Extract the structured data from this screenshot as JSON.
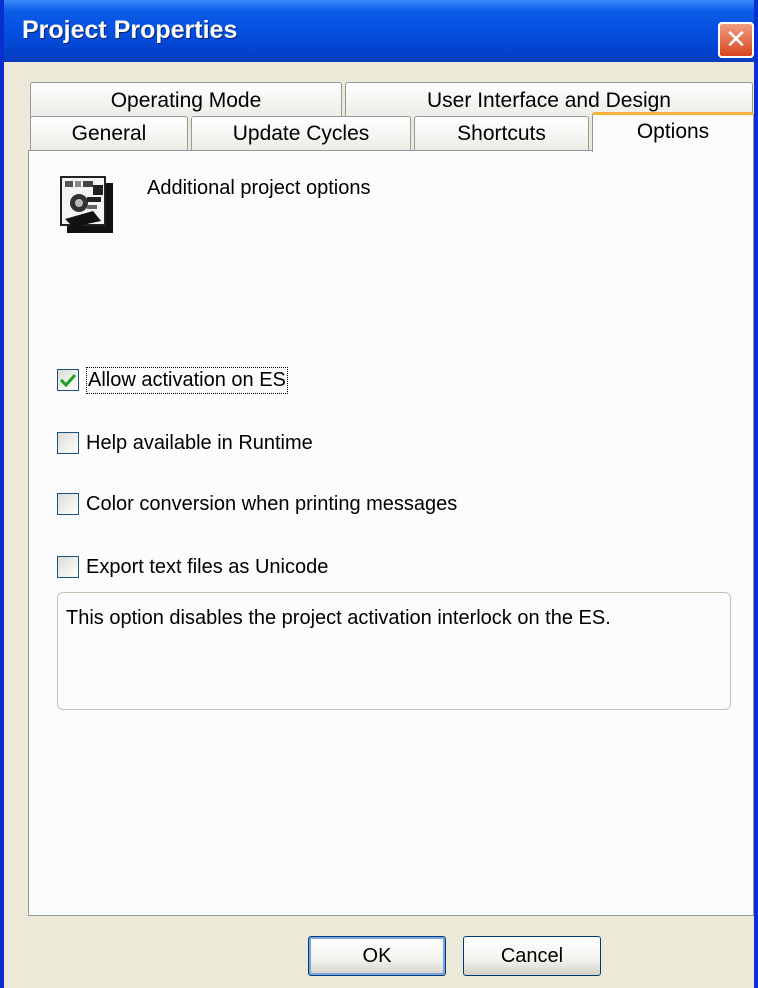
{
  "window": {
    "title": "Project Properties",
    "close_glyph": "✕"
  },
  "tabs": {
    "row_back": [
      {
        "label": "Operating Mode"
      },
      {
        "label": "User Interface and Design"
      }
    ],
    "row_front": [
      {
        "label": "General"
      },
      {
        "label": "Update Cycles"
      },
      {
        "label": "Shortcuts"
      },
      {
        "label": "Options",
        "active": true
      }
    ]
  },
  "options_panel": {
    "header": "Additional project options",
    "icon": "project-options-icon",
    "checkboxes": [
      {
        "label": "Allow activation on ES",
        "checked": true
      },
      {
        "label": "Help available in Runtime",
        "checked": false
      },
      {
        "label": "Color conversion when printing messages",
        "checked": false
      },
      {
        "label": "Export text files as Unicode",
        "checked": false
      }
    ],
    "description": "This option disables the project activation interlock on the ES."
  },
  "buttons": {
    "ok": "OK",
    "cancel": "Cancel"
  },
  "colors": {
    "title_bar": "#0550e0",
    "active_tab_accent": "#f7b03c",
    "check_mark": "#21a121"
  }
}
